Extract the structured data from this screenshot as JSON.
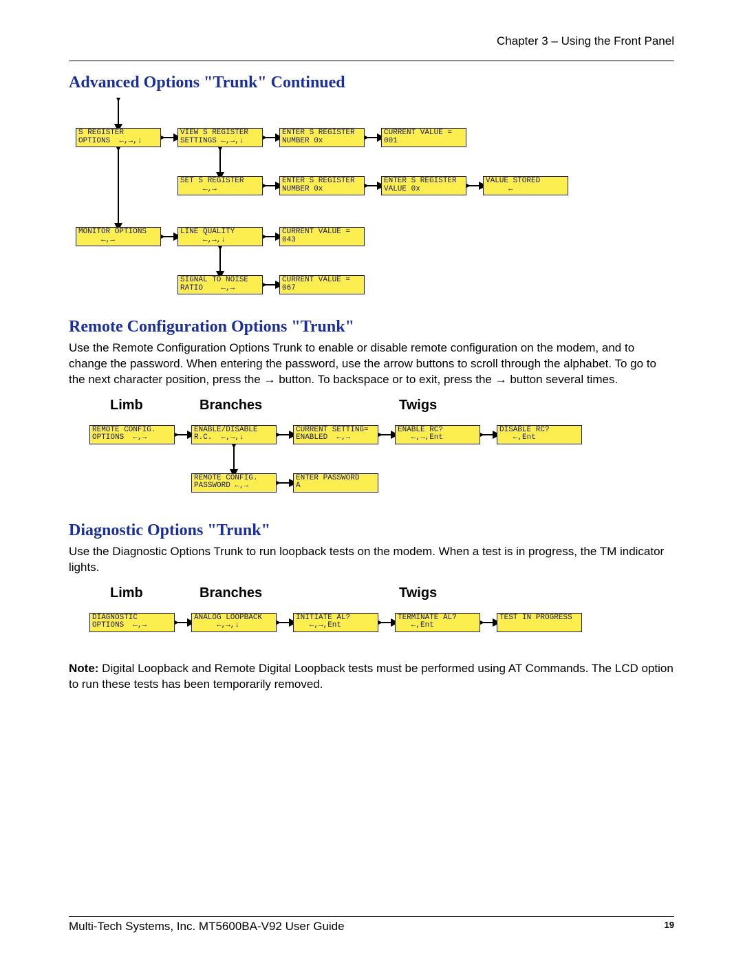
{
  "chapter_header": "Chapter 3 – Using the Front Panel",
  "section1": {
    "title": "Advanced Options \"Trunk\" Continued"
  },
  "section2": {
    "title": "Remote Configuration Options \"Trunk\"",
    "body1": "Use the Remote Configuration Options Trunk to enable or disable remote configuration on the modem, and to change the password. When entering the password, use the arrow buttons to scroll through the alphabet. To go to the next character position, press the ",
    "body2": " button. To backspace or to exit, press the ",
    "body3": " button several times.",
    "arrow": "→"
  },
  "section3": {
    "title": "Diagnostic Options \"Trunk\"",
    "body": "Use the Diagnostic Options Trunk to run loopback tests on the modem. When a test is in progress, the TM indicator lights."
  },
  "note": {
    "label": "Note:",
    "text": " Digital Loopback and Remote Digital Loopback tests must be performed using AT Commands. The LCD option to run these tests has been temporarily removed."
  },
  "columns": {
    "limb": "Limb",
    "branches": "Branches",
    "twigs": "Twigs"
  },
  "diagram1": {
    "s_register_options": "S REGISTER\nOPTIONS  ←,→,↓",
    "view_s_register": "VIEW S REGISTER\nSETTINGS ←,→,↓",
    "enter_s_register_num1": "ENTER S REGISTER\nNUMBER 0x",
    "current_value_001": "CURRENT VALUE =\n001",
    "set_s_register": "SET S REGISTER\n     ←,→",
    "enter_s_register_num2": "ENTER S REGISTER\nNUMBER 0x",
    "enter_s_register_val": "ENTER S REGISTER\nVALUE 0x",
    "value_stored": "VALUE STORED\n     ←",
    "monitor_options": "MONITOR OPTIONS\n     ←,→",
    "line_quality": "LINE QUALITY\n     ←,→,↓",
    "current_value_043": "CURRENT VALUE =\n043",
    "signal_to_noise": "SIGNAL TO NOISE\nRATIO    ←,→",
    "current_value_067": "CURRENT VALUE =\n067"
  },
  "diagram2": {
    "remote_config_options": "REMOTE CONFIG.\nOPTIONS  ←,→",
    "enable_disable_rc": "ENABLE/DISABLE\nR.C.  ←,→,↓",
    "current_setting_enabled": "CURRENT SETTING=\nENABLED  ←,→",
    "enable_rc": "ENABLE RC?\n   ←,→,Ent",
    "disable_rc": "DISABLE RC?\n   ←,Ent",
    "remote_config_password": "REMOTE CONFIG.\nPASSWORD ←,→",
    "enter_password": "ENTER PASSWORD\nA"
  },
  "diagram3": {
    "diagnostic_options": "DIAGNOSTIC\nOPTIONS  ←,→",
    "analog_loopback": "ANALOG LOOPBACK\n     ←,→,↓",
    "initiate_al": "INITIATE AL?\n   ←,→,Ent",
    "terminate_al": "TERMINATE AL?\n   ←,Ent",
    "test_in_progress": "TEST IN PROGRESS"
  },
  "footer": {
    "text": "Multi-Tech Systems, Inc. MT5600BA-V92 User Guide",
    "page": "19"
  }
}
